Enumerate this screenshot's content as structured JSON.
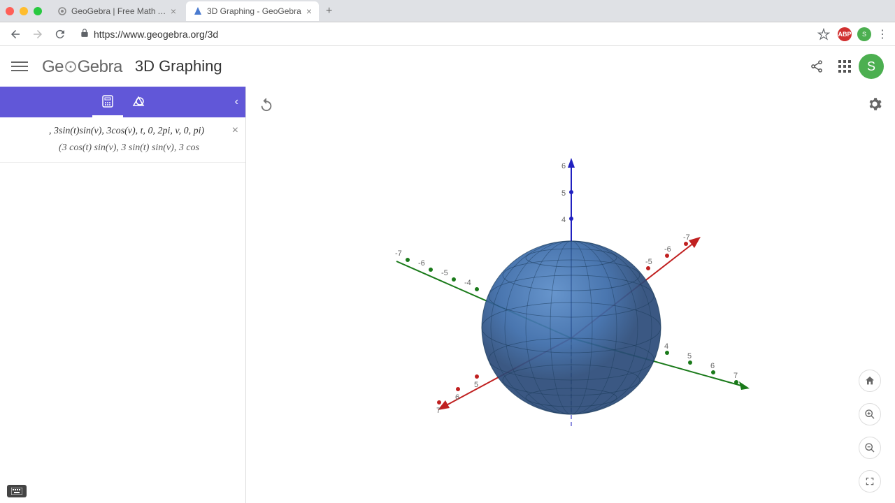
{
  "browser": {
    "tabs": [
      {
        "title": "GeoGebra | Free Math Apps - .",
        "active": false
      },
      {
        "title": "3D Graphing - GeoGebra",
        "active": true
      }
    ],
    "url": "https://www.geogebra.org/3d",
    "ext_abp": "ABP",
    "avatar_letter": "S"
  },
  "header": {
    "logo": "GeoGebra",
    "title": "3D Graphing",
    "avatar_letter": "S"
  },
  "sidebar": {
    "expression_main": ", 3sin(t)sin(v), 3cos(v), t, 0, 2pi, v, 0, pi)",
    "expression_sub": "(3 cos(t) sin(v), 3 sin(t) sin(v), 3 cos"
  },
  "axes": {
    "z_labels": [
      "6",
      "5",
      "4"
    ],
    "y_pos": [
      "4",
      "5",
      "6",
      "7"
    ],
    "y_neg": [
      "-4",
      "-5",
      "-6",
      "-7"
    ],
    "x_pos": [
      "5",
      "6",
      "7"
    ],
    "x_neg": [
      "-5",
      "-6",
      "-7"
    ]
  }
}
